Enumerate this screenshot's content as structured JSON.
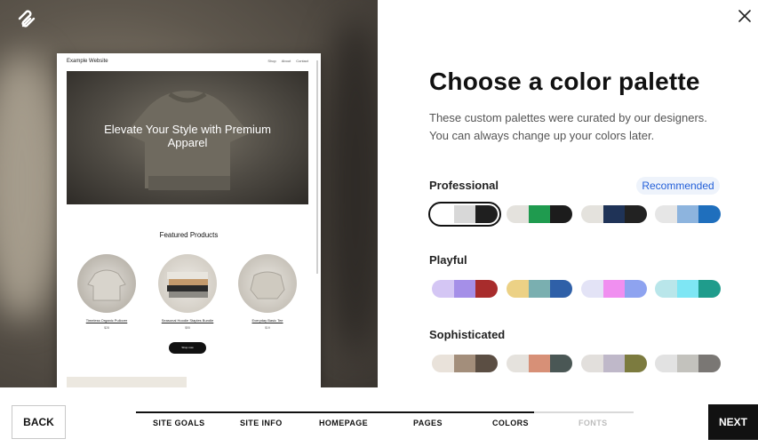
{
  "preview": {
    "site_name": "Example Website",
    "nav": [
      "Shop",
      "About",
      "Contact"
    ],
    "hero_title": "Elevate Your Style with Premium Apparel",
    "featured_title": "Featured Products",
    "products": [
      {
        "name": "Timeless Organic Pullover",
        "price": "$28"
      },
      {
        "name": "Seasonal Hoodie Staples Bundle",
        "price": "$55"
      },
      {
        "name": "Everyday Basic Tee",
        "price": "$19"
      }
    ],
    "shop_button": "Shop now"
  },
  "header": {
    "title": "Choose a color palette",
    "subtitle_line1": "These custom palettes were curated by our designers.",
    "subtitle_line2": "You can always change up your colors later."
  },
  "sections": [
    {
      "label": "Professional",
      "badge": "Recommended",
      "palettes": [
        {
          "colors": [
            "#ffffff",
            "#d8d8d8",
            "#1f1f1f"
          ],
          "selected": true
        },
        {
          "colors": [
            "#e4e2dd",
            "#1f9b4f",
            "#1c1c1c"
          ],
          "selected": false
        },
        {
          "colors": [
            "#e4e2dd",
            "#1f3357",
            "#222222"
          ],
          "selected": false
        },
        {
          "colors": [
            "#e6e6e6",
            "#8db4de",
            "#1f6fbd"
          ],
          "selected": false
        }
      ]
    },
    {
      "label": "Playful",
      "palettes": [
        {
          "colors": [
            "#d4c6f4",
            "#a58fe8",
            "#a82c2c"
          ],
          "selected": false
        },
        {
          "colors": [
            "#ecd185",
            "#7aafb0",
            "#2f60a8"
          ],
          "selected": false
        },
        {
          "colors": [
            "#e3e3f6",
            "#f08ff0",
            "#8ea3f0"
          ],
          "selected": false
        },
        {
          "colors": [
            "#b9e6ea",
            "#7ee6f4",
            "#1f9c8c"
          ],
          "selected": false
        }
      ]
    },
    {
      "label": "Sophisticated",
      "palettes": [
        {
          "colors": [
            "#e9e2da",
            "#a38e7b",
            "#5b4e43"
          ],
          "selected": false
        },
        {
          "colors": [
            "#e5e2dd",
            "#d79077",
            "#4a5755"
          ],
          "selected": false
        },
        {
          "colors": [
            "#e2dfdc",
            "#bfb8c9",
            "#7c7b3f"
          ],
          "selected": false
        },
        {
          "colors": [
            "#e2e2e2",
            "#c3c2bd",
            "#7a7774"
          ],
          "selected": false
        }
      ]
    }
  ],
  "footer": {
    "back_label": "BACK",
    "next_label": "NEXT",
    "steps": [
      {
        "label": "SITE GOALS",
        "active": true
      },
      {
        "label": "SITE INFO",
        "active": true
      },
      {
        "label": "HOMEPAGE",
        "active": true
      },
      {
        "label": "PAGES",
        "active": true
      },
      {
        "label": "COLORS",
        "active": true
      },
      {
        "label": "FONTS",
        "active": false
      }
    ],
    "progress_fraction": 0.8
  },
  "icons": {
    "logo": "squarespace-logo-icon",
    "close": "close-icon"
  }
}
